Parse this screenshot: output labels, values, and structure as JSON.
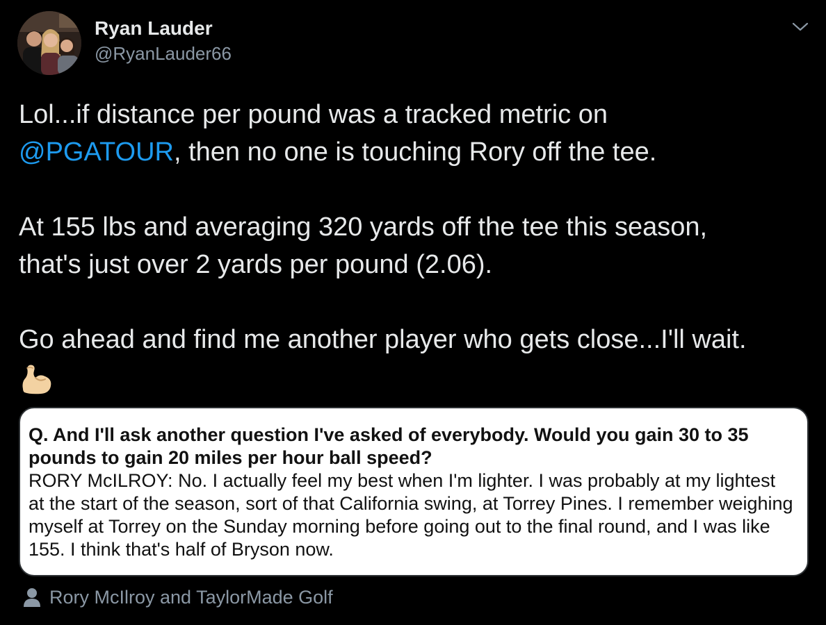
{
  "author": {
    "display_name": "Ryan Lauder",
    "handle": "@RyanLauder66",
    "avatar_icon": "avatar-photo"
  },
  "tweet": {
    "line1_before_mention": "Lol...if distance per pound was a tracked metric on",
    "mention": "@PGATOUR",
    "line1_after_mention": ", then no one is touching Rory off the tee.",
    "paragraph2": "At 155 lbs and averaging 320 yards off the tee this season, that's just over 2 yards per pound (2.06).",
    "paragraph3": "Go ahead and find me another player who gets close...I'll wait.",
    "emoji": "flexed-biceps-emoji"
  },
  "media": {
    "question": "Q. And I'll ask another question I've asked of everybody. Would you gain 30 to 35 pounds to gain 20 miles per hour ball speed?",
    "answer": "RORY McILROY: No. I actually feel my best when I'm lighter. I was probably at my lightest at the start of the season, sort of that California swing, at Torrey Pines. I remember weighing myself at Torrey on the Sunday morning before going out to the final round, and I was like 155. I think that's half of Bryson now."
  },
  "tagged_users": {
    "text": "Rory McIlroy and TaylorMade Golf",
    "icon": "person-icon"
  },
  "colors": {
    "background": "#000000",
    "text": "#e7e9ea",
    "secondary_text": "#8b98a5",
    "link": "#1d9bf0"
  }
}
